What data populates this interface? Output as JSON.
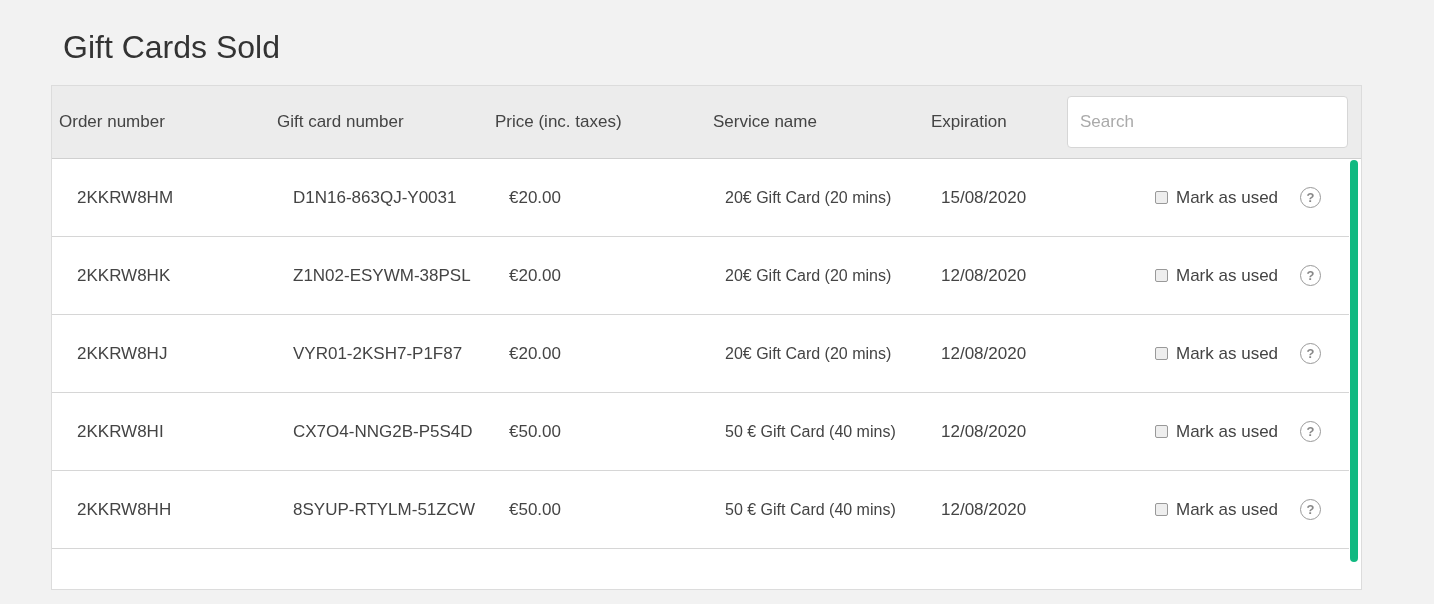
{
  "title": "Gift Cards Sold",
  "table": {
    "columns": [
      "Order number",
      "Gift card number",
      "Price (inc. taxes)",
      "Service name",
      "Expiration"
    ],
    "search": {
      "placeholder": "Search"
    },
    "rows": [
      {
        "order_number": "2KKRW8HM",
        "gift_card_number": "D1N16-863QJ-Y0031",
        "price": "€20.00",
        "service_name": "20€ Gift Card (20 mins)",
        "expiration": "15/08/2020",
        "mark_label": "Mark as used",
        "checked": false,
        "help": "?"
      },
      {
        "order_number": "2KKRW8HK",
        "gift_card_number": "Z1N02-ESYWM-38PSL",
        "price": "€20.00",
        "service_name": "20€ Gift Card (20 mins)",
        "expiration": "12/08/2020",
        "mark_label": "Mark as used",
        "checked": false,
        "help": "?"
      },
      {
        "order_number": "2KKRW8HJ",
        "gift_card_number": "VYR01-2KSH7-P1F87",
        "price": "€20.00",
        "service_name": "20€ Gift Card (20 mins)",
        "expiration": "12/08/2020",
        "mark_label": "Mark as used",
        "checked": false,
        "help": "?"
      },
      {
        "order_number": "2KKRW8HI",
        "gift_card_number": "CX7O4-NNG2B-P5S4D",
        "price": "€50.00",
        "service_name": "50 € Gift Card (40 mins)",
        "expiration": "12/08/2020",
        "mark_label": "Mark as used",
        "checked": false,
        "help": "?"
      },
      {
        "order_number": "2KKRW8HH",
        "gift_card_number": "8SYUP-RTYLM-51ZCW",
        "price": "€50.00",
        "service_name": "50 € Gift Card (40 mins)",
        "expiration": "12/08/2020",
        "mark_label": "Mark as used",
        "checked": false,
        "help": "?"
      }
    ]
  }
}
